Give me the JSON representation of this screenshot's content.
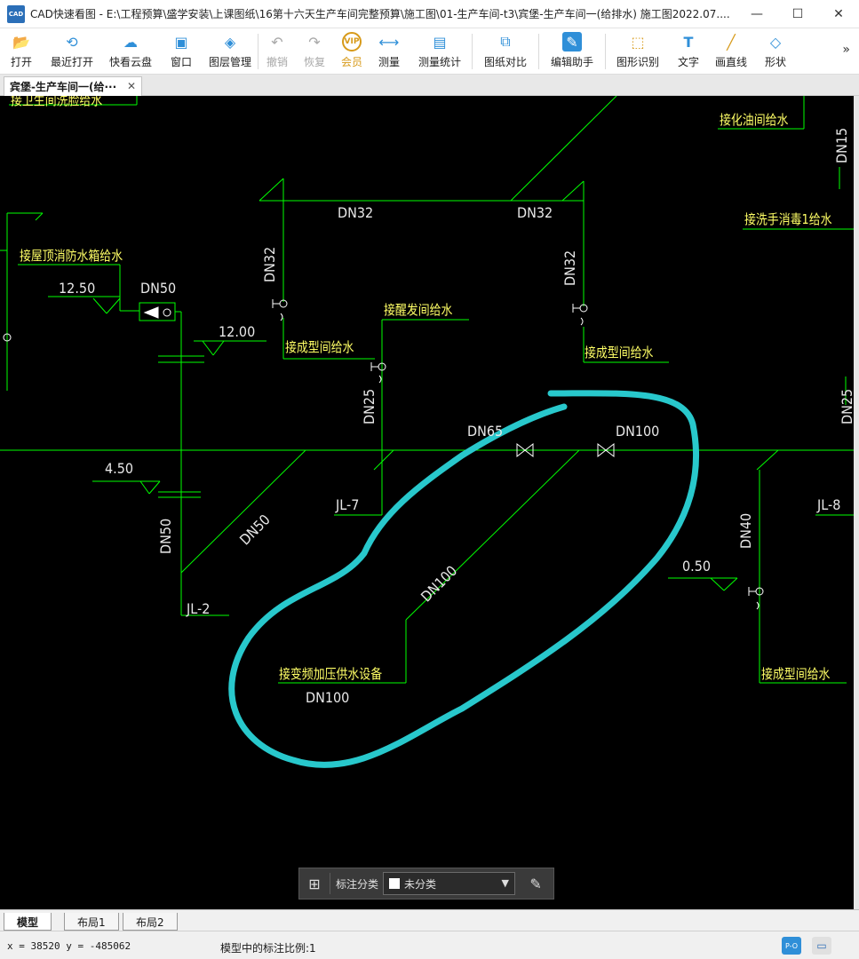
{
  "window": {
    "app_icon_text": "CAD",
    "title": "CAD快速看图 - E:\\工程预算\\盛学安装\\上课图纸\\16第十六天生产车间完整预算\\施工图\\01-生产车间-t3\\宾堡-生产车间一(给排水) 施工图2022.07....",
    "minimize": "—",
    "maximize": "☐",
    "close": "✕"
  },
  "toolbar": {
    "items": [
      {
        "label": "打开",
        "icon": "folder-icon",
        "glyph": "📂"
      },
      {
        "label": "最近打开",
        "icon": "history-icon",
        "glyph": "⟲"
      },
      {
        "label": "快看云盘",
        "icon": "cloud-icon",
        "glyph": "☁"
      },
      {
        "label": "窗口",
        "icon": "window-icon",
        "glyph": "▣"
      },
      {
        "label": "图层管理",
        "icon": "layers-icon",
        "glyph": "◈"
      },
      {
        "label": "撤销",
        "icon": "undo-icon",
        "glyph": "↶"
      },
      {
        "label": "恢复",
        "icon": "redo-icon",
        "glyph": "↷"
      },
      {
        "label": "会员",
        "icon": "vip-icon",
        "glyph": "VIP"
      },
      {
        "label": "测量",
        "icon": "ruler-icon",
        "glyph": "⟷"
      },
      {
        "label": "测量统计",
        "icon": "measure-stats-icon",
        "glyph": "▤"
      },
      {
        "label": "图纸对比",
        "icon": "compare-icon",
        "glyph": "⧉"
      },
      {
        "label": "编辑助手",
        "icon": "edit-assistant-icon",
        "glyph": "✎"
      },
      {
        "label": "图形识别",
        "icon": "shape-recognize-icon",
        "glyph": "⬚"
      },
      {
        "label": "文字",
        "icon": "text-icon",
        "glyph": "T"
      },
      {
        "label": "画直线",
        "icon": "line-icon",
        "glyph": "╱"
      },
      {
        "label": "形状",
        "icon": "shapes-icon",
        "glyph": "◇"
      }
    ],
    "more": "»"
  },
  "tab": {
    "label": "宾堡-生产车间一(给···",
    "close": "✕"
  },
  "drawing": {
    "texts": {
      "top_left_cut": "接卫生间洗脸给水",
      "oil_room": "接化油间给水",
      "dn15_right": "DN15",
      "wash_disinfect": "接洗手消毒1给水",
      "roof_tank": "接屋顶消防水箱给水",
      "elev_1250": "12.50",
      "dn50_top": "DN50",
      "elev_1200": "12.00",
      "dn32_h1": "DN32",
      "dn32_h2": "DN32",
      "dn32_v1": "DN32",
      "dn32_v2": "DN32",
      "forming_1": "接成型间给水",
      "forming_2": "接成型间给水",
      "ferment": "接醒发间给水",
      "dn25_v": "DN25",
      "dn25_right": "DN25",
      "dn65": "DN65",
      "dn100_h": "DN100",
      "elev_450": "4.50",
      "jl7": "JL-7",
      "jl8": "JL-8",
      "jl2": "JL-2",
      "dn50_v": "DN50",
      "dn50_diag": "DN50",
      "dn40": "DN40",
      "elev_050": "0.50",
      "dn100_diag": "DN100",
      "vfd_supply": "接变频加压供水设备",
      "dn100_bottom": "DN100",
      "forming_3": "接成型间给水"
    }
  },
  "annotation_bar": {
    "grid_glyph": "⊞",
    "label": "标注分类",
    "selected": "未分类",
    "arrow": "▼",
    "edit_glyph": "✎"
  },
  "layout_tabs": [
    "模型",
    "布局1",
    "布局2"
  ],
  "status": {
    "coords": "x = 38520  y = -485062",
    "scale": "模型中的标注比例:1",
    "btn1": "P-O",
    "btn2": "▭"
  },
  "colors": {
    "pipe": "#00ff00",
    "text": "#ffff66",
    "label": "#e8e8e8",
    "markup": "#28c8cc"
  }
}
